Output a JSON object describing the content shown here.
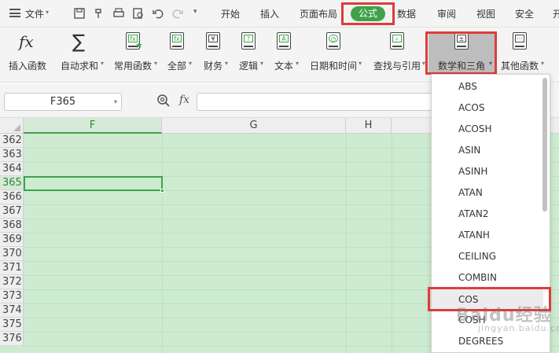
{
  "menubar": {
    "file_label": "文件",
    "tabs": [
      "开始",
      "插入",
      "页面布局",
      "公式",
      "数据",
      "审阅",
      "视图",
      "安全",
      "开"
    ],
    "active_tab": "公式"
  },
  "ribbon": {
    "buttons": [
      {
        "label": "插入函数",
        "icon": "fx-icon"
      },
      {
        "label": "自动求和",
        "icon": "sigma-icon"
      },
      {
        "label": "常用函数",
        "icon": "star-function-icon"
      },
      {
        "label": "全部",
        "icon": "all-functions-icon"
      },
      {
        "label": "财务",
        "icon": "finance-icon"
      },
      {
        "label": "逻辑",
        "icon": "logic-icon"
      },
      {
        "label": "文本",
        "icon": "text-icon"
      },
      {
        "label": "日期和时间",
        "icon": "clock-icon"
      },
      {
        "label": "查找与引用",
        "icon": "lookup-icon"
      },
      {
        "label": "数学和三角",
        "icon": "math-trig-icon"
      },
      {
        "label": "其他函数",
        "icon": "more-functions-icon"
      }
    ]
  },
  "formula_bar": {
    "name_box": "F365",
    "fx_label": "fx",
    "formula": ""
  },
  "grid": {
    "columns": [
      "F",
      "G",
      "H"
    ],
    "selected_column": "F",
    "rows": [
      "362",
      "363",
      "364",
      "365",
      "366",
      "367",
      "368",
      "369",
      "370",
      "371",
      "372",
      "373",
      "374",
      "375",
      "376"
    ],
    "active_row": "365"
  },
  "dropdown": {
    "items": [
      "ABS",
      "ACOS",
      "ACOSH",
      "ASIN",
      "ASINH",
      "ATAN",
      "ATAN2",
      "ATANH",
      "CEILING",
      "COMBIN",
      "COS",
      "COSH",
      "DEGREES"
    ],
    "highlighted": "COS"
  },
  "watermark": {
    "text": "Baidu经验",
    "sub": "jingyan.baidu.com"
  },
  "colors": {
    "accent": "#3fa24a",
    "highlight_box": "#e03b3b",
    "sheet_bg": "#cdebd0"
  }
}
